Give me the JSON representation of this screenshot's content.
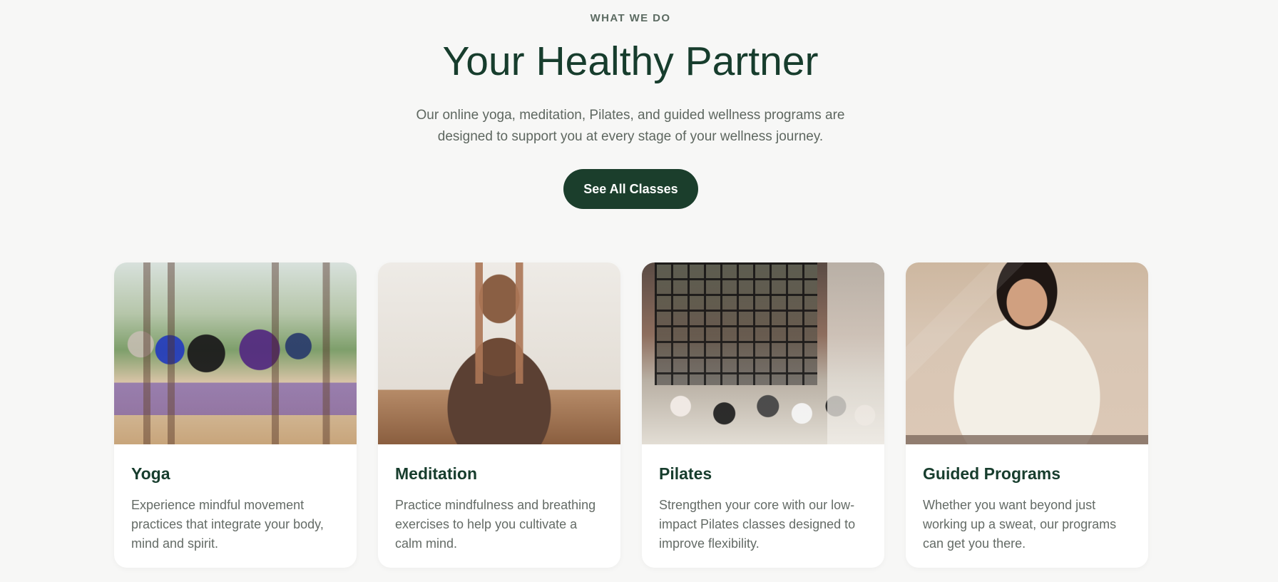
{
  "section": {
    "eyebrow": "WHAT WE DO",
    "title": "Your Healthy Partner",
    "description": "Our online yoga, meditation, Pilates, and guided wellness programs are designed to support you at every stage of your wellness journey.",
    "cta_label": "See All Classes"
  },
  "cards": [
    {
      "title": "Yoga",
      "text": "Experience mindful movement practices that integrate your body, mind and spirit."
    },
    {
      "title": "Meditation",
      "text": "Practice mindfulness and breathing exercises to help you cultivate a calm mind."
    },
    {
      "title": "Pilates",
      "text": "Strengthen your core with our low-impact Pilates classes designed to improve flexibility."
    },
    {
      "title": "Guided Programs",
      "text": "Whether you want beyond just working up a sweat, our programs can get you there."
    }
  ],
  "colors": {
    "background": "#f7f7f6",
    "primary": "#1b3e2c",
    "heading": "#173d2d",
    "body_text": "#646b66"
  }
}
